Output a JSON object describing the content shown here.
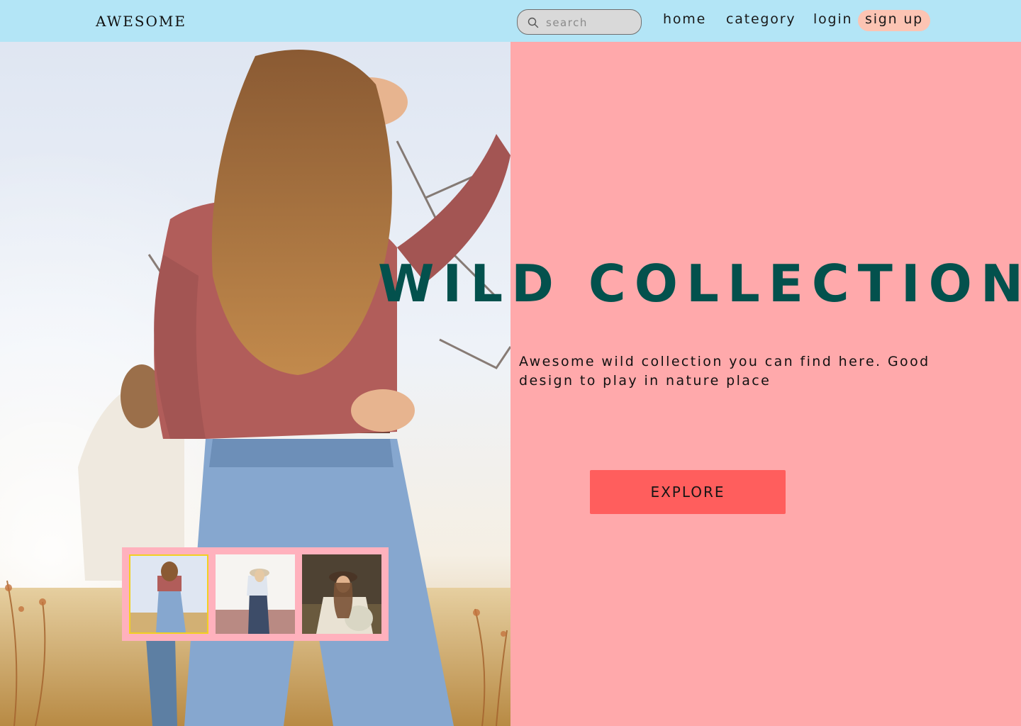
{
  "header": {
    "logo": "AWESOME",
    "search": {
      "placeholder": "search",
      "value": ""
    },
    "nav": {
      "home": "home",
      "category": "category",
      "login": "login",
      "signup": "sign up"
    }
  },
  "hero": {
    "title": "WILD COLLECTION",
    "description": "Awesome wild collection you can find here. Good design to play in nature place",
    "cta_label": "EXPLORE"
  },
  "thumbnails": {
    "selected_index": 0,
    "count": 3
  },
  "colors": {
    "header_bg": "#b3e5f6",
    "panel_bg": "#ffa9ab",
    "title": "#03514d",
    "cta_bg": "#ff5e5d",
    "signup_bg": "#fcc4b3",
    "thumb_strip_bg": "#ffb1bd",
    "thumb_selected_border": "#f2d021"
  },
  "icons": {
    "search": "search-icon"
  }
}
